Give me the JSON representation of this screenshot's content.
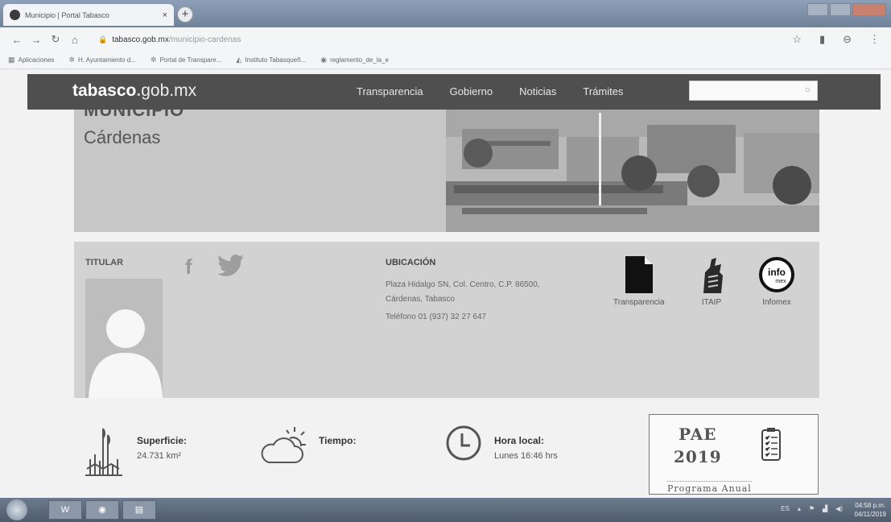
{
  "browser": {
    "tab_title": "Municipio | Portal Tabasco",
    "tab_close": "×",
    "new_tab": "+",
    "url_host": "tabasco.gob.mx",
    "url_path": "/municipio-cardenas",
    "bookmarks": [
      {
        "label": "Aplicaciones",
        "icon": "apps-grid-icon"
      },
      {
        "label": "H. Ayuntamiento d...",
        "icon": "seal-icon"
      },
      {
        "label": "Portal de Transpare...",
        "icon": "seal-icon"
      },
      {
        "label": "Instituto Tabasqueñ...",
        "icon": "bookmark-icon"
      },
      {
        "label": "reglamento_de_la_e",
        "icon": "chrome-icon"
      }
    ]
  },
  "site": {
    "logo_main": "tabasco",
    "logo_dot": ".",
    "logo_suffix": "gob.mx",
    "nav": [
      "Transparencia",
      "Gobierno",
      "Noticias",
      "Trámites"
    ],
    "search_placeholder": ""
  },
  "hero": {
    "label": "MUNICIPIO",
    "name": "Cárdenas"
  },
  "info": {
    "titular_label": "TITULAR",
    "fb_glyph": "f",
    "ubicacion_label": "UBICACIÓN",
    "address_line1": "Plaza Hidalgo SN, Col. Centro, C.P. 86500,",
    "address_line2": "Cárdenas, Tabasco",
    "phone": "Teléfono 01 (937) 32 27 647",
    "links": {
      "transparencia": "Transparencia",
      "itaip": "ITAIP",
      "infomex": "Infomex"
    },
    "infomex_logo_text": "info",
    "infomex_logo_sub": "mex"
  },
  "stats": {
    "superficie_label": "Superficie:",
    "superficie_value": "24.731 km²",
    "tiempo_label": "Tiempo:",
    "hora_label": "Hora local:",
    "hora_value": "Lunes 16:46 hrs"
  },
  "pae": {
    "title_line1": "PAE",
    "title_line2": "2019",
    "subtitle": "Programa Anual"
  },
  "taskbar": {
    "app_word": "W",
    "tray_lang": "ES",
    "time": "04:58 p.m.",
    "date": "04/11/2019"
  }
}
